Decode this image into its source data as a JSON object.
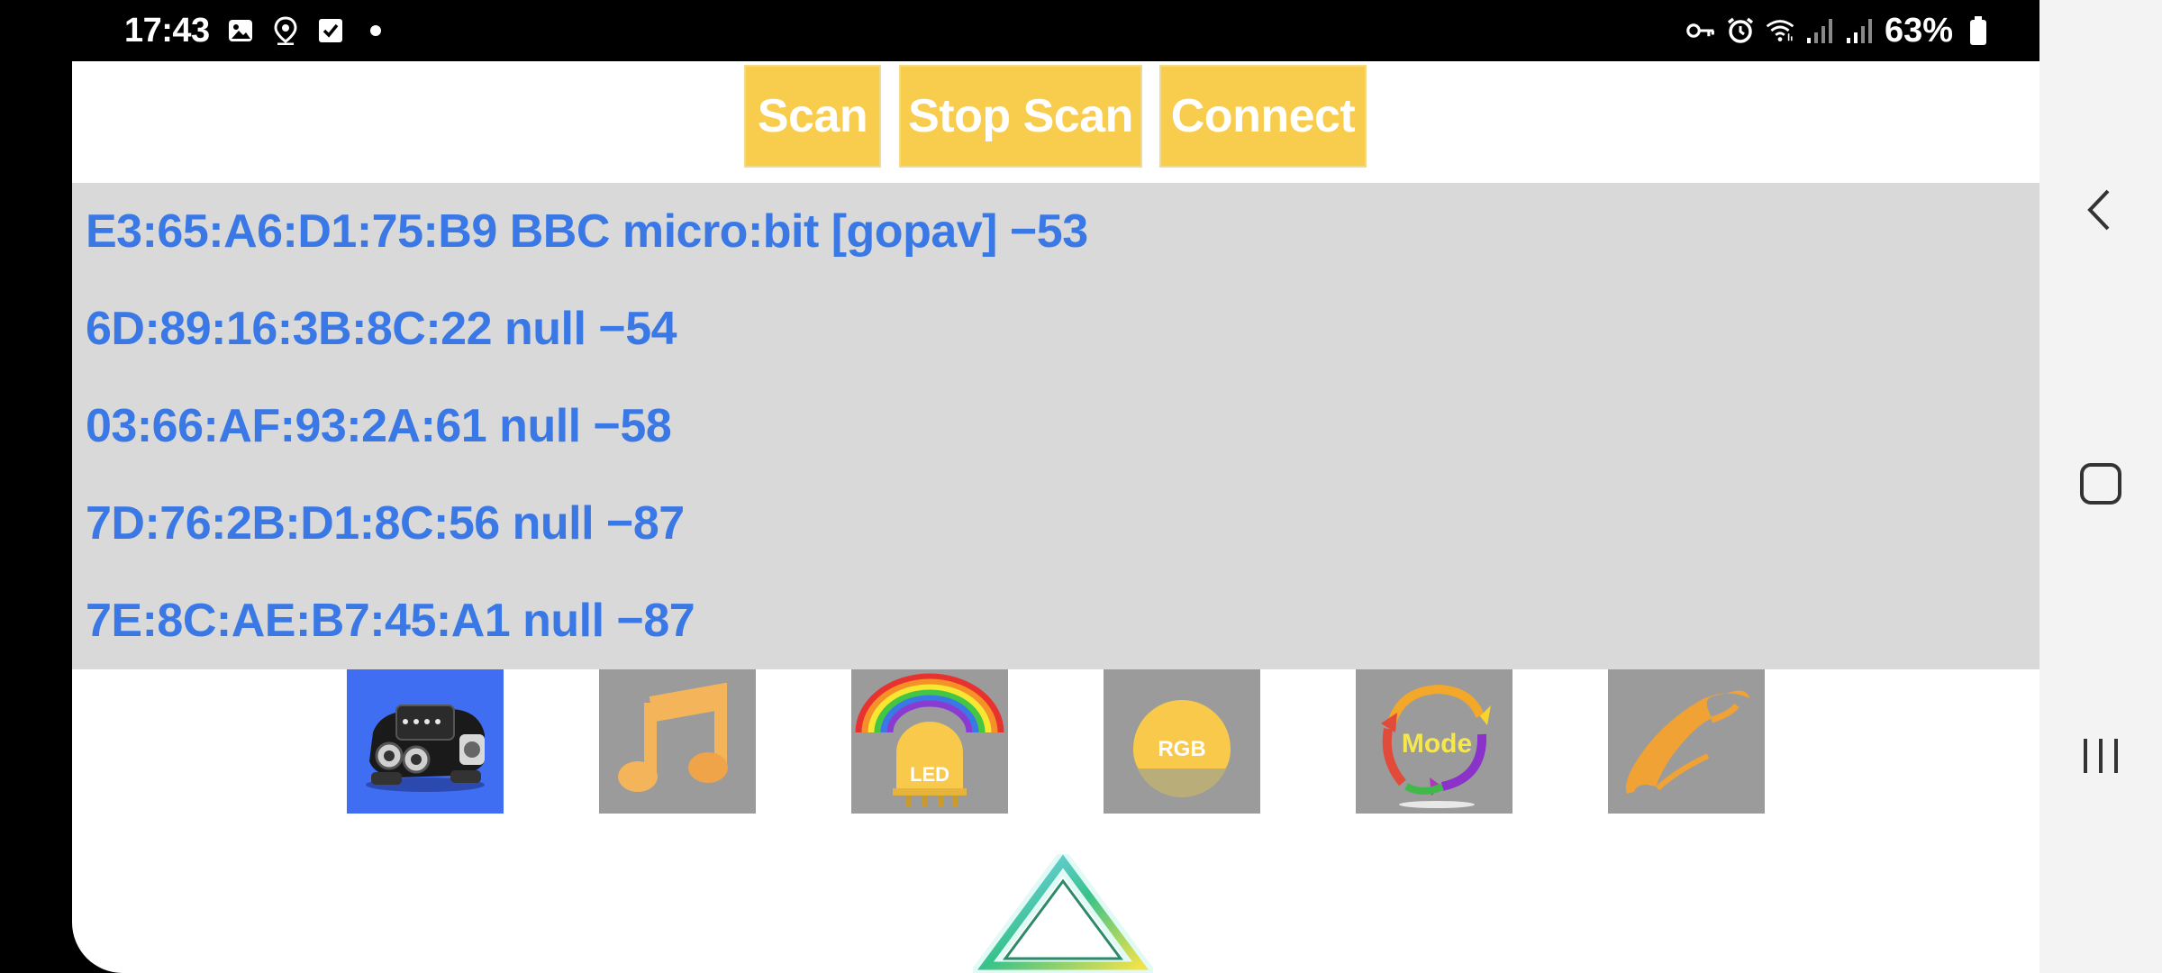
{
  "status_bar": {
    "time": "17:43",
    "left_icons": [
      "image-icon",
      "location-icon",
      "checkbox-icon",
      "dot-icon"
    ],
    "right_icons": [
      "vpn-key-icon",
      "alarm-icon",
      "wifi-icon",
      "signal-icon",
      "signal-icon"
    ],
    "battery": "63%"
  },
  "toolbar": {
    "scan_label": "Scan",
    "stop_scan_label": "Stop Scan",
    "connect_label": "Connect",
    "button_color": "#f8cd4d"
  },
  "devices": [
    "E3:65:A6:D1:75:B9 BBC micro:bit [gopav] −53",
    "6D:89:16:3B:8C:22 null −54",
    "03:66:AF:93:2A:61 null −58",
    "7D:76:2B:D1:8C:56 null −87",
    "7E:8C:AE:B7:45:A1 null −87"
  ],
  "feature_tiles": {
    "robot": "robot-car-icon",
    "music": "music-note-icon",
    "led": "LED",
    "rgb": "RGB",
    "mode": "Mode",
    "phone": "phone-icon"
  },
  "colors": {
    "device_text": "#3a78e6",
    "list_bg": "#d9d9d9",
    "tile_bg": "#9b9b9b",
    "active_tile_bg": "#3f6ef2"
  },
  "navigation": [
    "back-icon",
    "home-icon",
    "recents-icon"
  ]
}
